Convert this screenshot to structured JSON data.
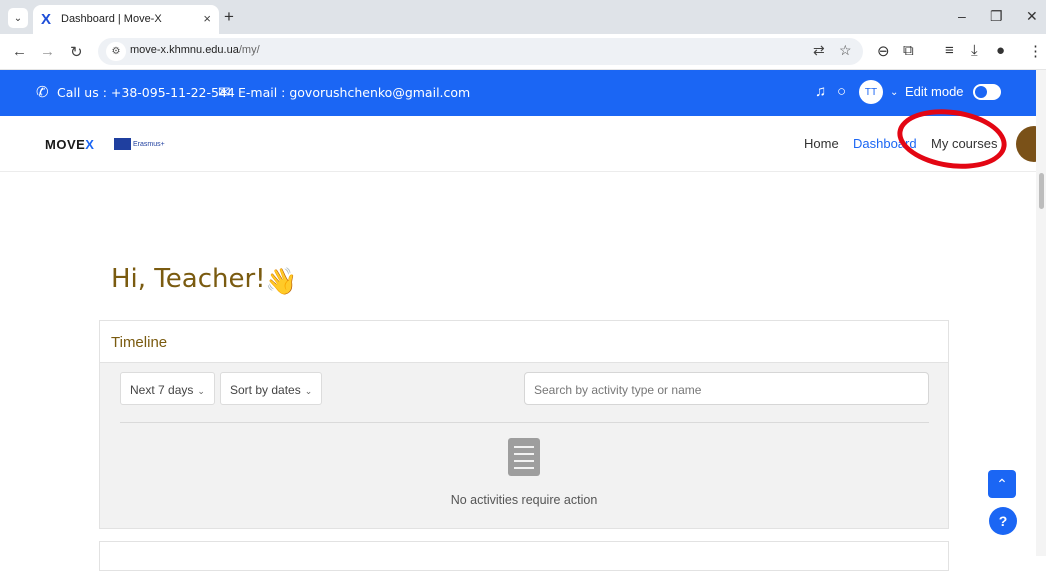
{
  "browser": {
    "tab_title": "Dashboard | Move-X",
    "url_host": "move-x.khmnu.edu.ua",
    "url_path": "/my/"
  },
  "topbar": {
    "call_text": "Call us : +38-095-11-22-544",
    "email_text": "E-mail : govorushchenko@gmail.com",
    "avatar_initials": "TT",
    "edit_mode_label": "Edit mode"
  },
  "nav": {
    "logo_move": "MOVE",
    "logo_x": "X",
    "erasmus": "Erasmus+",
    "home": "Home",
    "dashboard": "Dashboard",
    "my_courses": "My courses"
  },
  "main": {
    "greeting": "Hi, Teacher!",
    "wave_emoji": "👋"
  },
  "timeline": {
    "title": "Timeline",
    "filter_label": "Next 7 days",
    "sort_label": "Sort by dates",
    "search_placeholder": "Search by activity type or name",
    "empty_text": "No activities require action"
  },
  "colors": {
    "accent": "#1b66f4",
    "heading": "#7a5b10",
    "annotation": "#e30613"
  }
}
